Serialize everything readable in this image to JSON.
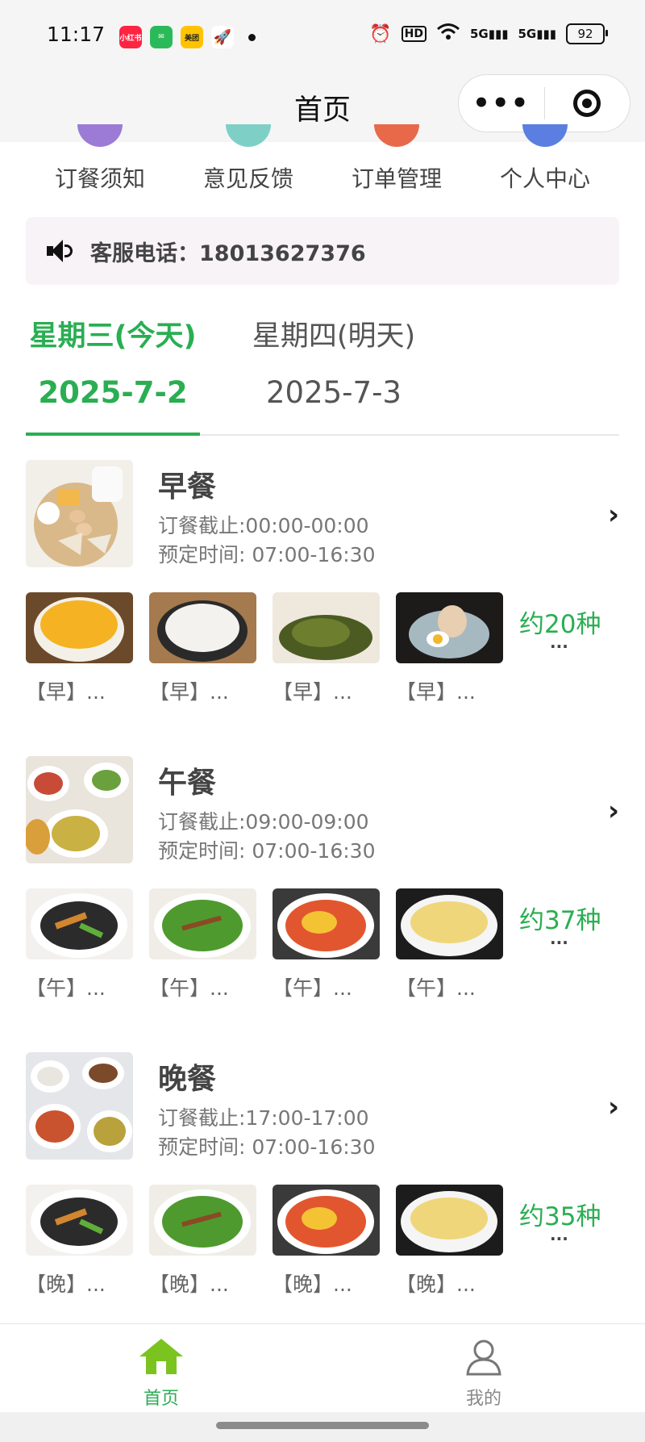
{
  "status_bar": {
    "time": "11:17",
    "apps": [
      {
        "label": "小红书",
        "color": "#ff2442"
      },
      {
        "label": "✉",
        "color": "#2bba5a"
      },
      {
        "label": "美团",
        "color": "#ffc300"
      },
      {
        "label": "🚀",
        "color": "#ffffff"
      }
    ],
    "network": "5G",
    "hd": "HD",
    "battery": "92"
  },
  "nav": {
    "title": "首页",
    "more": "•••"
  },
  "quick_menu": [
    {
      "label": "订餐须知",
      "color": "#9b7bd6"
    },
    {
      "label": "意见反馈",
      "color": "#7ed0c7"
    },
    {
      "label": "订单管理",
      "color": "#e8694a"
    },
    {
      "label": "个人中心",
      "color": "#5b7fe0"
    }
  ],
  "hotline": {
    "text": "客服电话：18013627376"
  },
  "tabs": [
    {
      "day": "星期三(今天)",
      "date": "2025-7-2",
      "active": true
    },
    {
      "day": "星期四(明天)",
      "date": "2025-7-3",
      "active": false
    }
  ],
  "meals": [
    {
      "title": "早餐",
      "deadline": "订餐截止:00:00-00:00",
      "booking": "预定时间: 07:00-16:30",
      "count": "约20种",
      "count_more": "...",
      "dishes": [
        "【早】...",
        "【早】...",
        "【早】...",
        "【早】..."
      ]
    },
    {
      "title": "午餐",
      "deadline": "订餐截止:09:00-09:00",
      "booking": "预定时间: 07:00-16:30",
      "count": "约37种",
      "count_more": "...",
      "dishes": [
        "【午】...",
        "【午】...",
        "【午】...",
        "【午】..."
      ]
    },
    {
      "title": "晚餐",
      "deadline": "订餐截止:17:00-17:00",
      "booking": "预定时间: 07:00-16:30",
      "count": "约35种",
      "count_more": "...",
      "dishes": [
        "【晚】...",
        "【晚】...",
        "【晚】...",
        "【晚】..."
      ]
    }
  ],
  "tabbar": {
    "home": "首页",
    "mine": "我的",
    "active_color": "#2aae52",
    "inactive_color": "#888888"
  }
}
